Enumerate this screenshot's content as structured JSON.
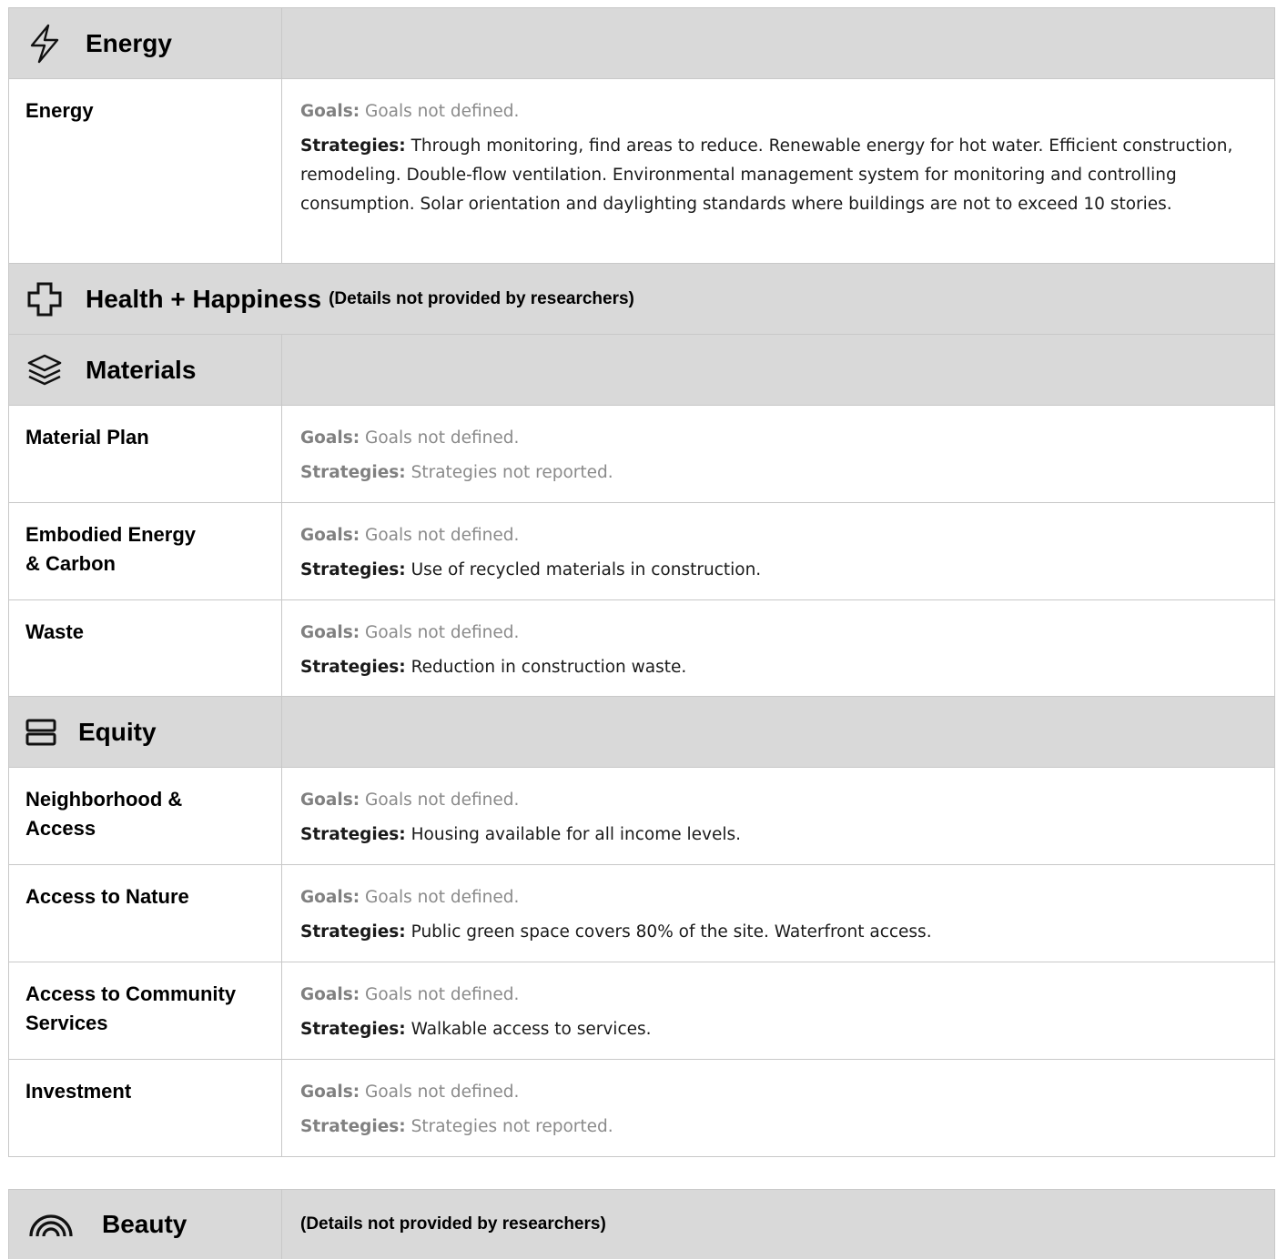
{
  "sections": {
    "energy": {
      "title": "Energy",
      "icon": "lightning-icon",
      "rows": [
        {
          "name": "Energy",
          "goals_label": "Goals:",
          "goals": "Goals not defined.",
          "strategies_label": "Strategies:",
          "strategies": "Through monitoring, find areas to reduce. Renewable energy for hot water. Efficient construction, remodeling. Double-flow ventilation. Environmental management system for monitoring and controlling consumption. Solar orientation and daylighting standards where buildings are not to exceed 10 stories."
        }
      ]
    },
    "health": {
      "title": "Health + Happiness",
      "icon": "plus-cross-icon",
      "note": "(Details not provided by researchers)"
    },
    "materials": {
      "title": "Materials",
      "icon": "layers-icon",
      "rows": [
        {
          "name": "Material Plan",
          "goals_label": "Goals:",
          "goals": "Goals not defined.",
          "strategies_label": "Strategies:",
          "strategies": "Strategies not reported."
        },
        {
          "name": "Embodied Energy & Carbon",
          "name_line1": "Embodied Energy",
          "name_line2": "& Carbon",
          "goals_label": "Goals:",
          "goals": "Goals not defined.",
          "strategies_label": "Strategies:",
          "strategies": "Use of recycled materials in construction."
        },
        {
          "name": "Waste",
          "goals_label": "Goals:",
          "goals": "Goals not defined.",
          "strategies_label": "Strategies:",
          "strategies": "Reduction in construction waste."
        }
      ]
    },
    "equity": {
      "title": "Equity",
      "icon": "stacked-bars-icon",
      "rows": [
        {
          "name_line1": "Neighborhood &",
          "name_line2": "Access",
          "goals_label": "Goals:",
          "goals": "Goals not defined.",
          "strategies_label": "Strategies:",
          "strategies": "Housing available for all income levels."
        },
        {
          "name": "Access to Nature",
          "goals_label": "Goals:",
          "goals": "Goals not defined.",
          "strategies_label": "Strategies:",
          "strategies": "Public green space covers 80% of the site. Waterfront access."
        },
        {
          "name_line1": "Access to Community",
          "name_line2": "Services",
          "goals_label": "Goals:",
          "goals": "Goals not defined.",
          "strategies_label": "Strategies:",
          "strategies": "Walkable access to services."
        },
        {
          "name": "Investment",
          "goals_label": "Goals:",
          "goals": "Goals not defined.",
          "strategies_label": "Strategies:",
          "strategies": "Strategies not reported."
        }
      ]
    },
    "beauty": {
      "title": "Beauty",
      "icon": "rainbow-icon",
      "note": "(Details not provided by researchers)"
    }
  }
}
